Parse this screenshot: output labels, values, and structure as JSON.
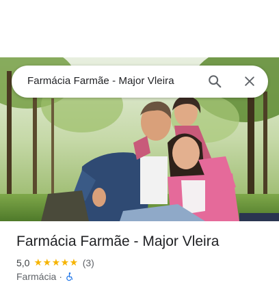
{
  "search": {
    "value": "Farmácia Farmãe - Major Vleira"
  },
  "place": {
    "title": "Farmácia Farmãe - Major Vleira",
    "rating": "5,0",
    "stars": "★★★★★",
    "review_count": "(3)",
    "category": "Farmácia",
    "separator": "·"
  },
  "colors": {
    "star": "#f6b400",
    "accessibility": "#1a73e8",
    "title": "#202124"
  },
  "icons": [
    "search-icon",
    "close-icon",
    "wheelchair-icon"
  ]
}
